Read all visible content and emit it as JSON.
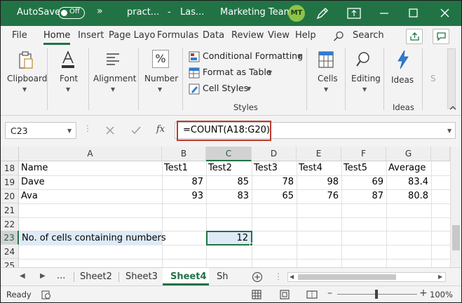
{
  "titlebar": {
    "autosave_label": "AutoSave",
    "autosave_state": "Off",
    "more_symbol": "»",
    "file_name": "pract...",
    "location": "Las...",
    "team_name": "Marketing Team",
    "avatar_initials": "MT",
    "accent_color": "#217346"
  },
  "tabs": [
    {
      "label": "File"
    },
    {
      "label": "Home"
    },
    {
      "label": "Insert"
    },
    {
      "label": "Page Layo"
    },
    {
      "label": "Formulas"
    },
    {
      "label": "Data"
    },
    {
      "label": "Review"
    },
    {
      "label": "View"
    },
    {
      "label": "Help"
    }
  ],
  "search_label": "Search",
  "ribbon": {
    "clipboard": "Clipboard",
    "font": "Font",
    "alignment": "Alignment",
    "number": "Number",
    "conditional_formatting": "Conditional Formatting",
    "format_as_table": "Format as Table",
    "cell_styles": "Cell Styles",
    "styles_group": "Styles",
    "cells": "Cells",
    "editing": "Editing",
    "ideas": "Ideas",
    "ideas_group": "Ideas",
    "overflow": "S"
  },
  "formula_bar": {
    "name_box": "C23",
    "fx": "fx",
    "formula": "=COUNT(A18:G20)"
  },
  "columns": [
    "A",
    "B",
    "C",
    "D",
    "E",
    "F",
    "G"
  ],
  "selected_column": "C",
  "rows": [
    {
      "num": "18",
      "cells": [
        "Name",
        "Test1",
        "Test2",
        "Test3",
        "Test4",
        "Test5",
        "Average"
      ]
    },
    {
      "num": "19",
      "cells": [
        "Dave",
        "87",
        "85",
        "78",
        "98",
        "69",
        "83.4"
      ]
    },
    {
      "num": "20",
      "cells": [
        "Ava",
        "93",
        "83",
        "65",
        "76",
        "87",
        "80.8"
      ]
    },
    {
      "num": "21",
      "cells": [
        "",
        "",
        "",
        "",
        "",
        "",
        ""
      ]
    },
    {
      "num": "22",
      "cells": [
        "",
        "",
        "",
        "",
        "",
        "",
        ""
      ]
    },
    {
      "num": "23",
      "cells": [
        "No. of cells containing numbers",
        "",
        "12",
        "",
        "",
        "",
        ""
      ]
    },
    {
      "num": "24",
      "cells": [
        "",
        "",
        "",
        "",
        "",
        "",
        ""
      ]
    },
    {
      "num": "25",
      "cells": [
        "",
        "",
        "",
        "",
        "",
        "",
        ""
      ]
    }
  ],
  "sheet_tabs": {
    "ellipsis": "...",
    "tabs": [
      "Sheet2",
      "Sheet3",
      "Sheet4",
      "Sh"
    ],
    "active": "Sheet4"
  },
  "status": {
    "ready": "Ready",
    "zoom": "100%"
  }
}
